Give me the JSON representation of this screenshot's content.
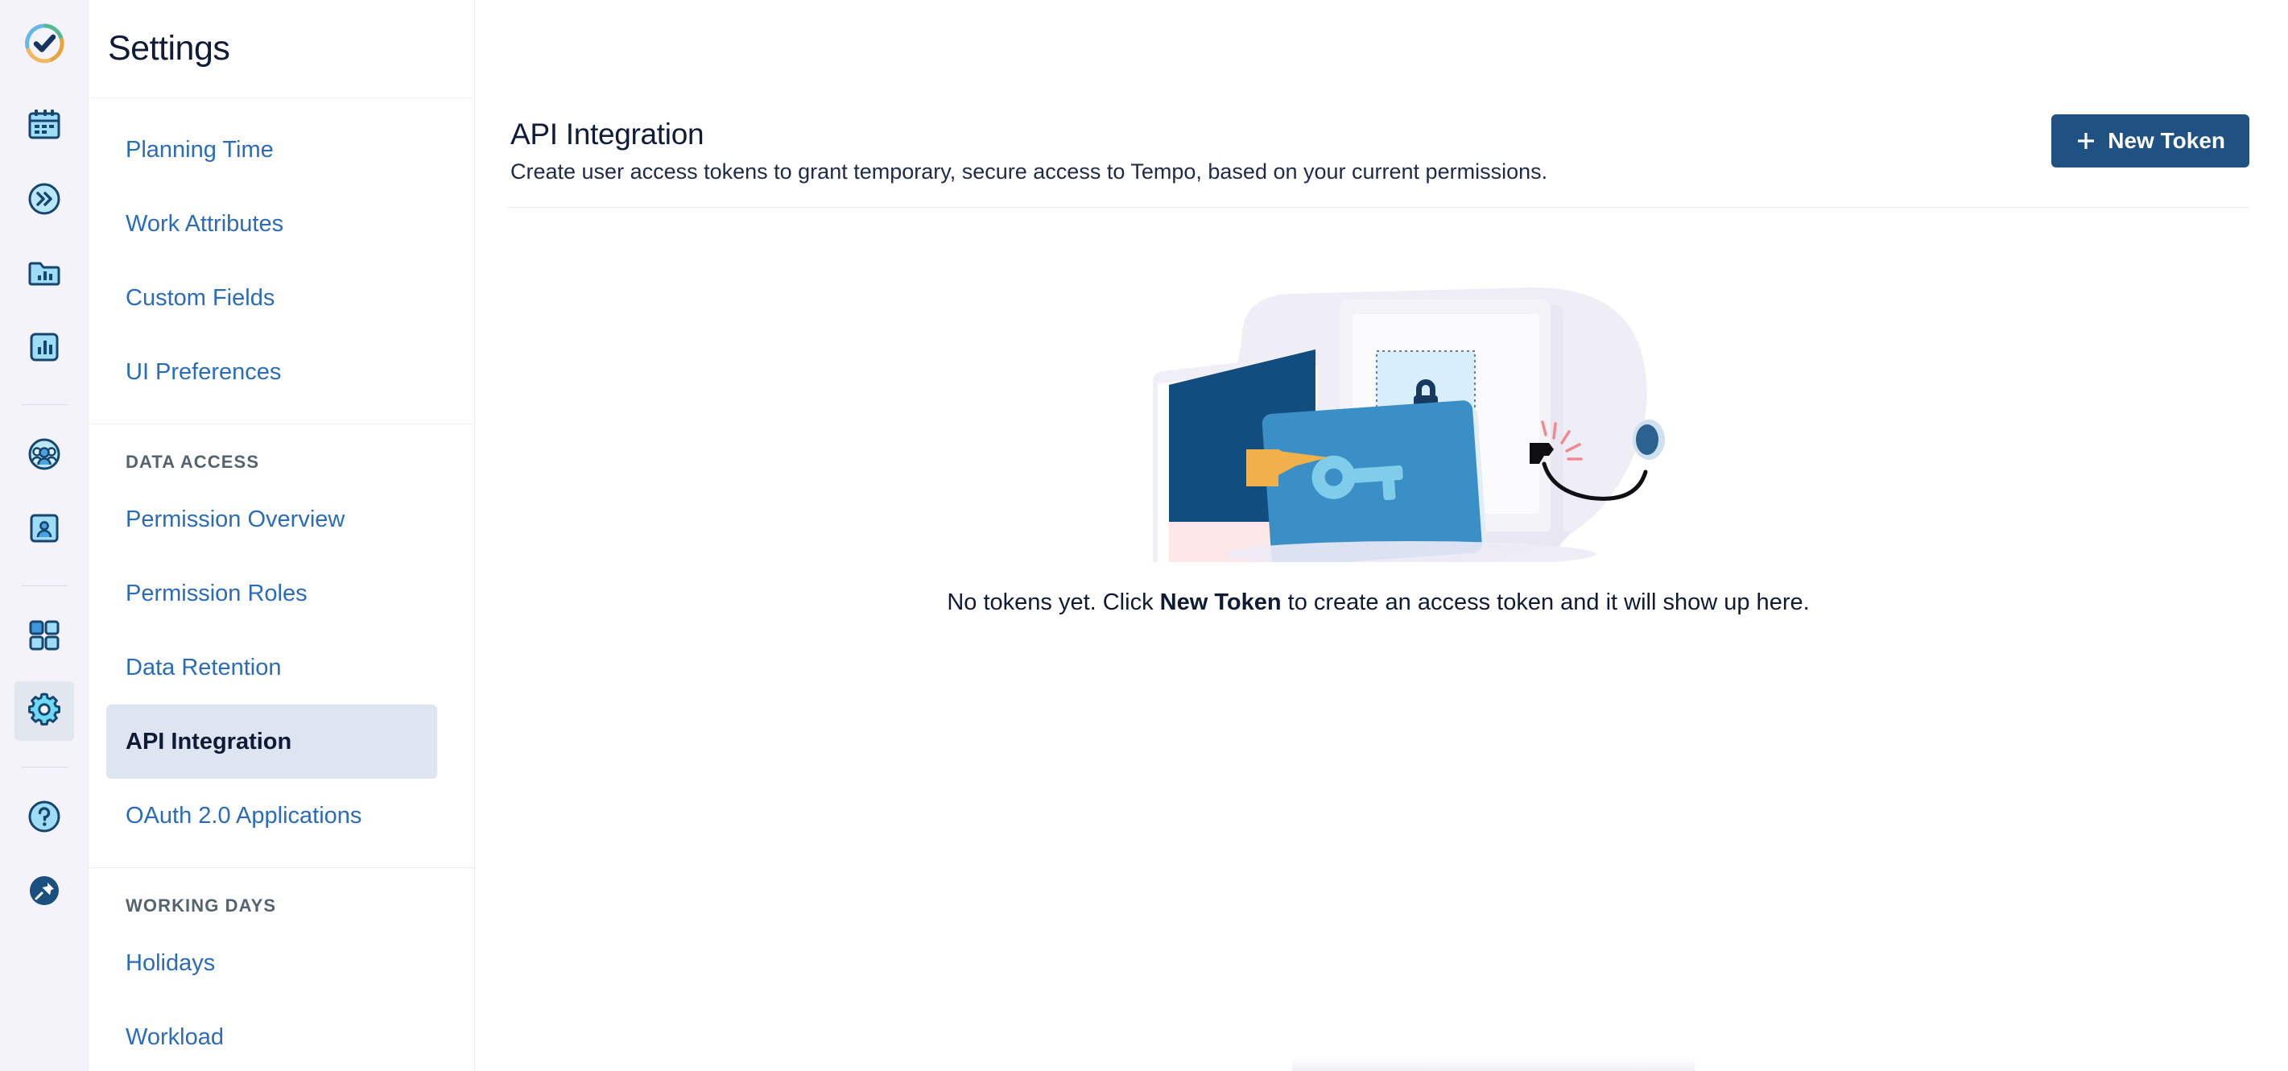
{
  "rail": {
    "logo": {
      "name": "tempo-logo",
      "label": "Tempo"
    },
    "items": [
      {
        "icon": "calendar-icon",
        "label": "Calendar",
        "selected": false
      },
      {
        "icon": "fast-forward-icon",
        "label": "Timesheets",
        "selected": false
      },
      {
        "icon": "folder-chart-icon",
        "label": "Projects",
        "selected": false
      },
      {
        "icon": "report-chart-icon",
        "label": "Reports",
        "selected": false
      },
      {
        "icon": "team-people-icon",
        "label": "Teams",
        "selected": false
      },
      {
        "icon": "user-card-icon",
        "label": "Accounts",
        "selected": false
      },
      {
        "icon": "apps-grid-icon",
        "label": "Apps",
        "selected": false
      },
      {
        "icon": "gear-icon",
        "label": "Settings",
        "selected": true
      },
      {
        "icon": "help-circle-icon",
        "label": "Help",
        "selected": false
      },
      {
        "icon": "pin-icon",
        "label": "Pin",
        "selected": false
      }
    ]
  },
  "nav": {
    "title": "Settings",
    "items_top": [
      {
        "label": "Planning Time",
        "active": false
      },
      {
        "label": "Work Attributes",
        "active": false
      },
      {
        "label": "Custom Fields",
        "active": false
      },
      {
        "label": "UI Preferences",
        "active": false
      }
    ],
    "group_data_access": "DATA ACCESS",
    "items_data_access": [
      {
        "label": "Permission Overview",
        "active": false
      },
      {
        "label": "Permission Roles",
        "active": false
      },
      {
        "label": "Data Retention",
        "active": false
      },
      {
        "label": "API Integration",
        "active": true
      },
      {
        "label": "OAuth 2.0 Applications",
        "active": false
      }
    ],
    "group_working_days": "WORKING DAYS",
    "items_working_days": [
      {
        "label": "Holidays",
        "active": false
      },
      {
        "label": "Workload",
        "active": false
      }
    ]
  },
  "content": {
    "title": "API Integration",
    "subtitle": "Create user access tokens to grant temporary, secure access to Tempo, based on your current permissions.",
    "new_token_label": "New Token",
    "new_token_icon": "plus-icon",
    "empty_state": {
      "illustration": "lock-key-screen-illustration",
      "text_before": "No tokens yet. Click ",
      "text_strong": "New Token",
      "text_after": " to create an access token and it will show up here."
    }
  },
  "colors": {
    "rail_bg": "#f4f3fa",
    "nav_link": "#2b6cb8",
    "nav_active_bg": "#dde5f1",
    "button_bg": "#1f5282",
    "heading": "#101b37",
    "group_label": "#55636f"
  }
}
